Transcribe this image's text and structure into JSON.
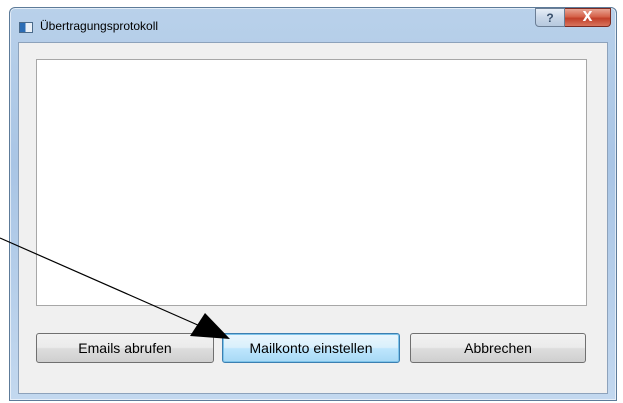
{
  "window": {
    "title": "Übertragungsprotokoll",
    "help_label": "?",
    "close_label": "X"
  },
  "log": {
    "content": ""
  },
  "buttons": {
    "fetch_emails": "Emails abrufen",
    "configure_account": "Mailkonto einstellen",
    "cancel": "Abbrechen"
  },
  "icons": {
    "app": "window-icon",
    "help": "help-icon",
    "close": "close-icon",
    "annotation": "arrow-annotation-icon"
  },
  "colors": {
    "titlebar": "#b9d1ea",
    "client_bg": "#f0f0f0",
    "close_button": "#c2402a",
    "focused_button_border": "#3c7fb1"
  }
}
